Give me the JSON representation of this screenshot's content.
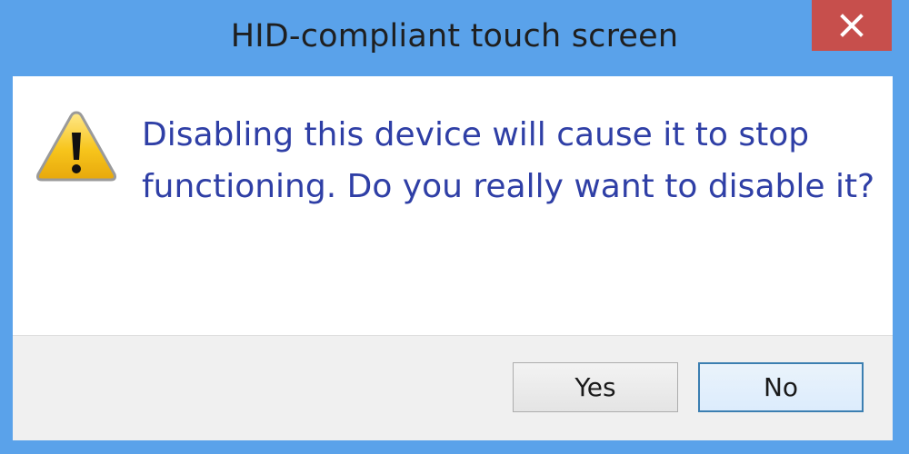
{
  "dialog": {
    "title": "HID-compliant touch screen",
    "message": "Disabling this device will cause it to stop functioning. Do you really want to disable it?",
    "icon": "warning-icon",
    "close_icon": "close-icon"
  },
  "buttons": {
    "yes_label": "Yes",
    "no_label": "No"
  },
  "colors": {
    "titlebar": "#5aa2ea",
    "close_button": "#c74f4c",
    "message_text": "#2f3fa6",
    "footer": "#f0f0f0",
    "default_button_border": "#3c7fb1"
  }
}
